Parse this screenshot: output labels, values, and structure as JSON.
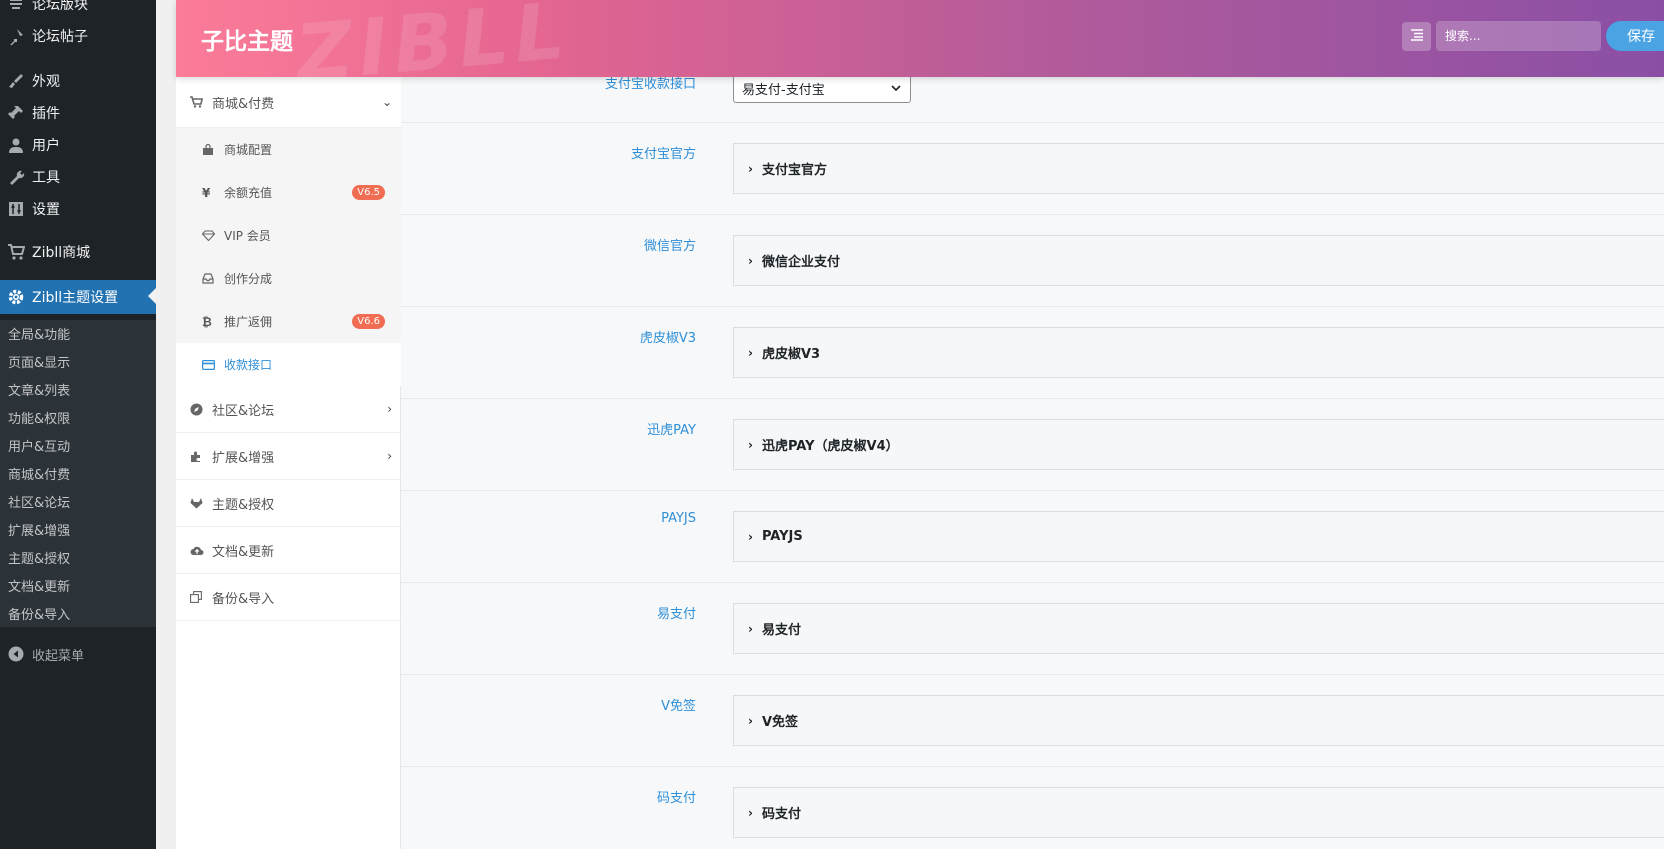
{
  "wp_menu": {
    "items": [
      {
        "label": "论坛版块",
        "icon": "forum-icon"
      },
      {
        "label": "论坛帖子",
        "icon": "pin-icon"
      },
      {
        "label": "外观",
        "icon": "brush-icon"
      },
      {
        "label": "插件",
        "icon": "plugin-icon"
      },
      {
        "label": "用户",
        "icon": "user-icon"
      },
      {
        "label": "工具",
        "icon": "wrench-icon"
      },
      {
        "label": "设置",
        "icon": "settings-icon"
      },
      {
        "label": "Zibll商城",
        "icon": "cart-icon"
      },
      {
        "label": "Zibll主题设置",
        "icon": "gear-icon"
      }
    ],
    "submenu": [
      "全局&功能",
      "页面&显示",
      "文章&列表",
      "功能&权限",
      "用户&互动",
      "商城&付费",
      "社区&论坛",
      "扩展&增强",
      "主题&授权",
      "文档&更新",
      "备份&导入"
    ],
    "collapse_label": "收起菜单"
  },
  "header": {
    "brand": "子比主题",
    "watermark": "ZIBLL",
    "search_placeholder": "搜索...",
    "save_label": "保存"
  },
  "nav": {
    "groups": [
      {
        "label": "商城&付费",
        "icon": "cart-icon",
        "expanded": true
      },
      {
        "label": "社区&论坛",
        "icon": "compass-icon"
      },
      {
        "label": "扩展&增强",
        "icon": "puzzle-icon"
      },
      {
        "label": "主题&授权",
        "icon": "gitlab-icon"
      },
      {
        "label": "文档&更新",
        "icon": "cloud-icon"
      },
      {
        "label": "备份&导入",
        "icon": "copy-icon"
      }
    ],
    "subitems": [
      {
        "label": "商城配置",
        "icon": "shopping-bag-icon"
      },
      {
        "label": "余额充值",
        "icon": "yen-icon",
        "badge": "V6.5"
      },
      {
        "label": "VIP 会员",
        "icon": "diamond-icon"
      },
      {
        "label": "创作分成",
        "icon": "inbox-icon"
      },
      {
        "label": "推广返佣",
        "icon": "bitcoin-icon",
        "badge": "V6.6"
      },
      {
        "label": "收款接口",
        "icon": "credit-card-icon",
        "selected": true
      }
    ]
  },
  "content": {
    "alipay_interface": {
      "label": "支付宝收款接口",
      "value": "易支付-支付宝"
    },
    "sections": [
      {
        "label": "支付宝官方",
        "title": "支付宝官方"
      },
      {
        "label": "微信官方",
        "title": "微信企业支付"
      },
      {
        "label": "虎皮椒V3",
        "title": "虎皮椒V3"
      },
      {
        "label": "迅虎PAY",
        "title": "迅虎PAY（虎皮椒V4）"
      },
      {
        "label": "PAYJS",
        "title": "PAYJS"
      },
      {
        "label": "易支付",
        "title": "易支付"
      },
      {
        "label": "V免签",
        "title": "V免签"
      },
      {
        "label": "码支付",
        "title": "码支付"
      }
    ]
  },
  "colors": {
    "accent": "#2f8fd8",
    "wp_active": "#2271b1",
    "badge": "#f06c52"
  }
}
